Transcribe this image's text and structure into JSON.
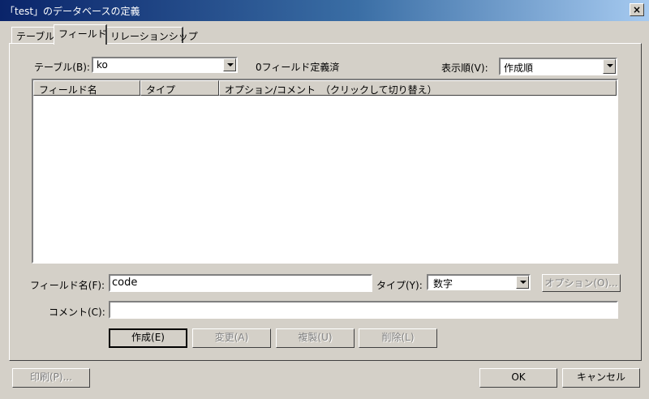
{
  "window": {
    "title": "「test」のデータベースの定義",
    "close_label": "×"
  },
  "tabs": [
    {
      "label": "テーブル"
    },
    {
      "label": "フィールド"
    },
    {
      "label": "リレーションシップ"
    }
  ],
  "table_select": {
    "label": "テーブル(B):",
    "value": "ko"
  },
  "field_count": "0フィールド定義済",
  "sort_select": {
    "label": "表示順(V):",
    "value": "作成順"
  },
  "list": {
    "columns": [
      {
        "label": "フィールド名"
      },
      {
        "label": "タイプ"
      },
      {
        "label": "オプション/コメント　（クリックして切り替え）"
      }
    ]
  },
  "field_name": {
    "label": "フィールド名(F):",
    "value": "code"
  },
  "type_select": {
    "label": "タイプ(Y):",
    "value": "数字"
  },
  "options_button": "オプション(O)...",
  "comment": {
    "label": "コメント(C):",
    "value": ""
  },
  "actions": {
    "create": "作成(E)",
    "change": "変更(A)",
    "duplicate": "複製(U)",
    "delete": "削除(L)"
  },
  "footer": {
    "print": "印刷(P)...",
    "ok": "OK",
    "cancel": "キャンセル"
  }
}
